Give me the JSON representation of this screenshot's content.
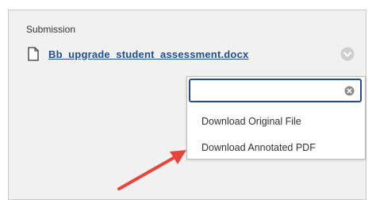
{
  "submission": {
    "label": "Submission",
    "file_name": "Bb_upgrade_student_assessment.docx",
    "file_icon": "document-icon",
    "menu_icon": "chevron-down-circle-icon"
  },
  "menu": {
    "search_value": "",
    "clear_icon": "clear-x-circle-icon",
    "items": [
      {
        "label": "Download Original File"
      },
      {
        "label": "Download Annotated PDF"
      }
    ]
  },
  "annotation": {
    "arrow_color": "#e8443a",
    "points_to": "Download Annotated PDF"
  },
  "colors": {
    "link": "#1f4d95",
    "panel_bg": "#f1f1f1",
    "focus_border": "#1f4d95"
  }
}
